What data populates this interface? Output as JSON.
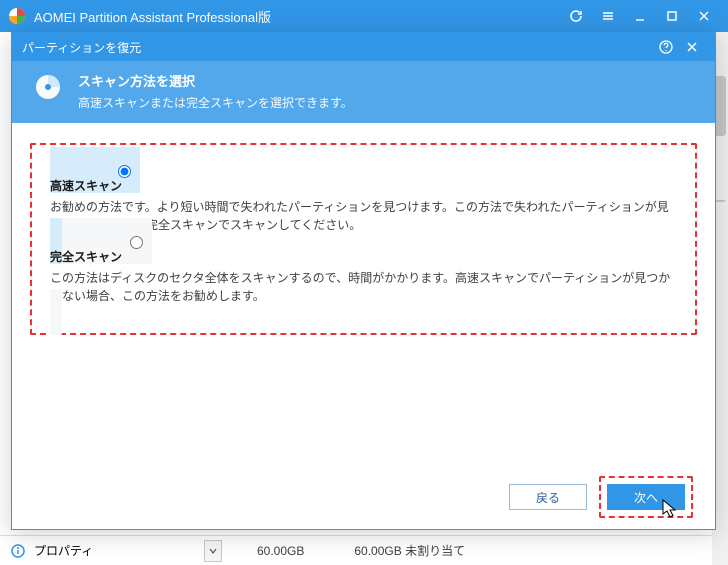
{
  "main_window": {
    "title": "AOMEI Partition Assistant Professional版"
  },
  "background": {
    "property_label": "プロパティ",
    "disk_size": "60.00GB",
    "disk_status": "60.00GB 未割り当て"
  },
  "dialog": {
    "title": "パーティションを復元",
    "header": {
      "title": "スキャン方法を選択",
      "subtitle": "高速スキャンまたは完全スキャンを選択できます。"
    },
    "options": {
      "fast": {
        "title": "高速スキャン",
        "desc": "お勧めの方法です。より短い時間で失われたパーティションを見つけます。この方法で失われたパーティションが見つからない場合、完全スキャンでスキャンしてください。"
      },
      "full": {
        "title": "完全スキャン",
        "desc": "この方法はディスクのセクタ全体をスキャンするので、時間がかかります。高速スキャンでパーティションが見つからない場合、この方法をお勧めします。"
      }
    },
    "buttons": {
      "back": "戻る",
      "next": "次へ"
    }
  }
}
